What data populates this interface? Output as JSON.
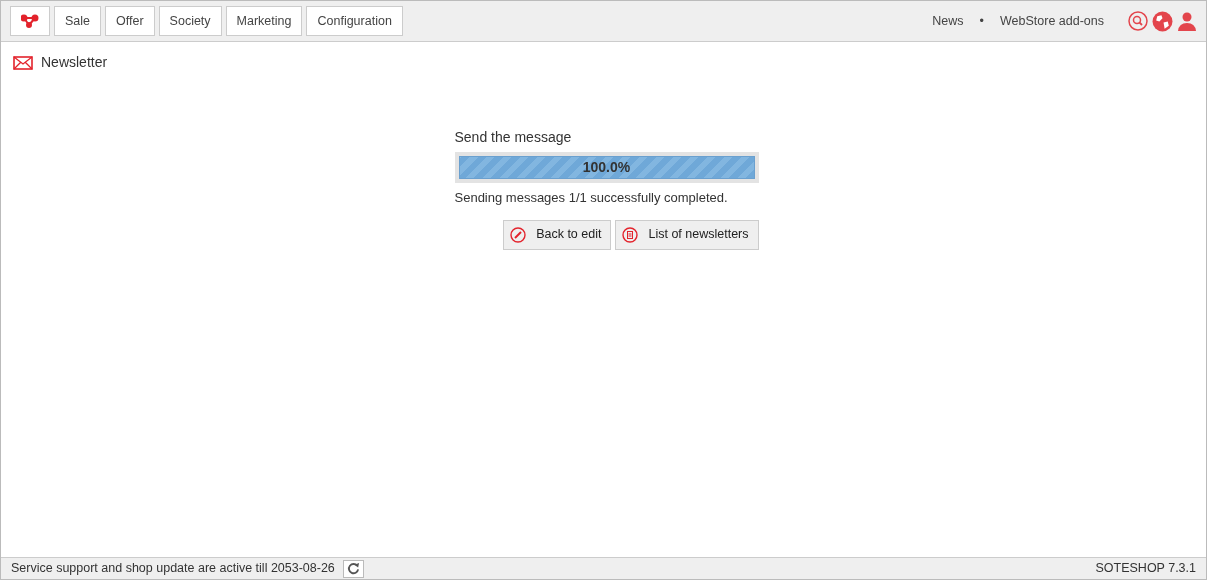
{
  "top_menu": [
    "Sale",
    "Offer",
    "Society",
    "Marketing",
    "Configuration"
  ],
  "top_links": [
    "News",
    "•",
    "WebStore add-ons"
  ],
  "page_title": "Newsletter",
  "progress": {
    "title": "Send the message",
    "level": 1,
    "reading": "100.0%",
    "message": "Sending messages 1/1 successfully completed."
  },
  "buttons": [
    "Back to edit",
    "List of newsletters"
  ],
  "status_bar": {
    "support": "Service support and shop update are active till 2053-08-26",
    "version": "SOTESHOP 7.3.1"
  }
}
